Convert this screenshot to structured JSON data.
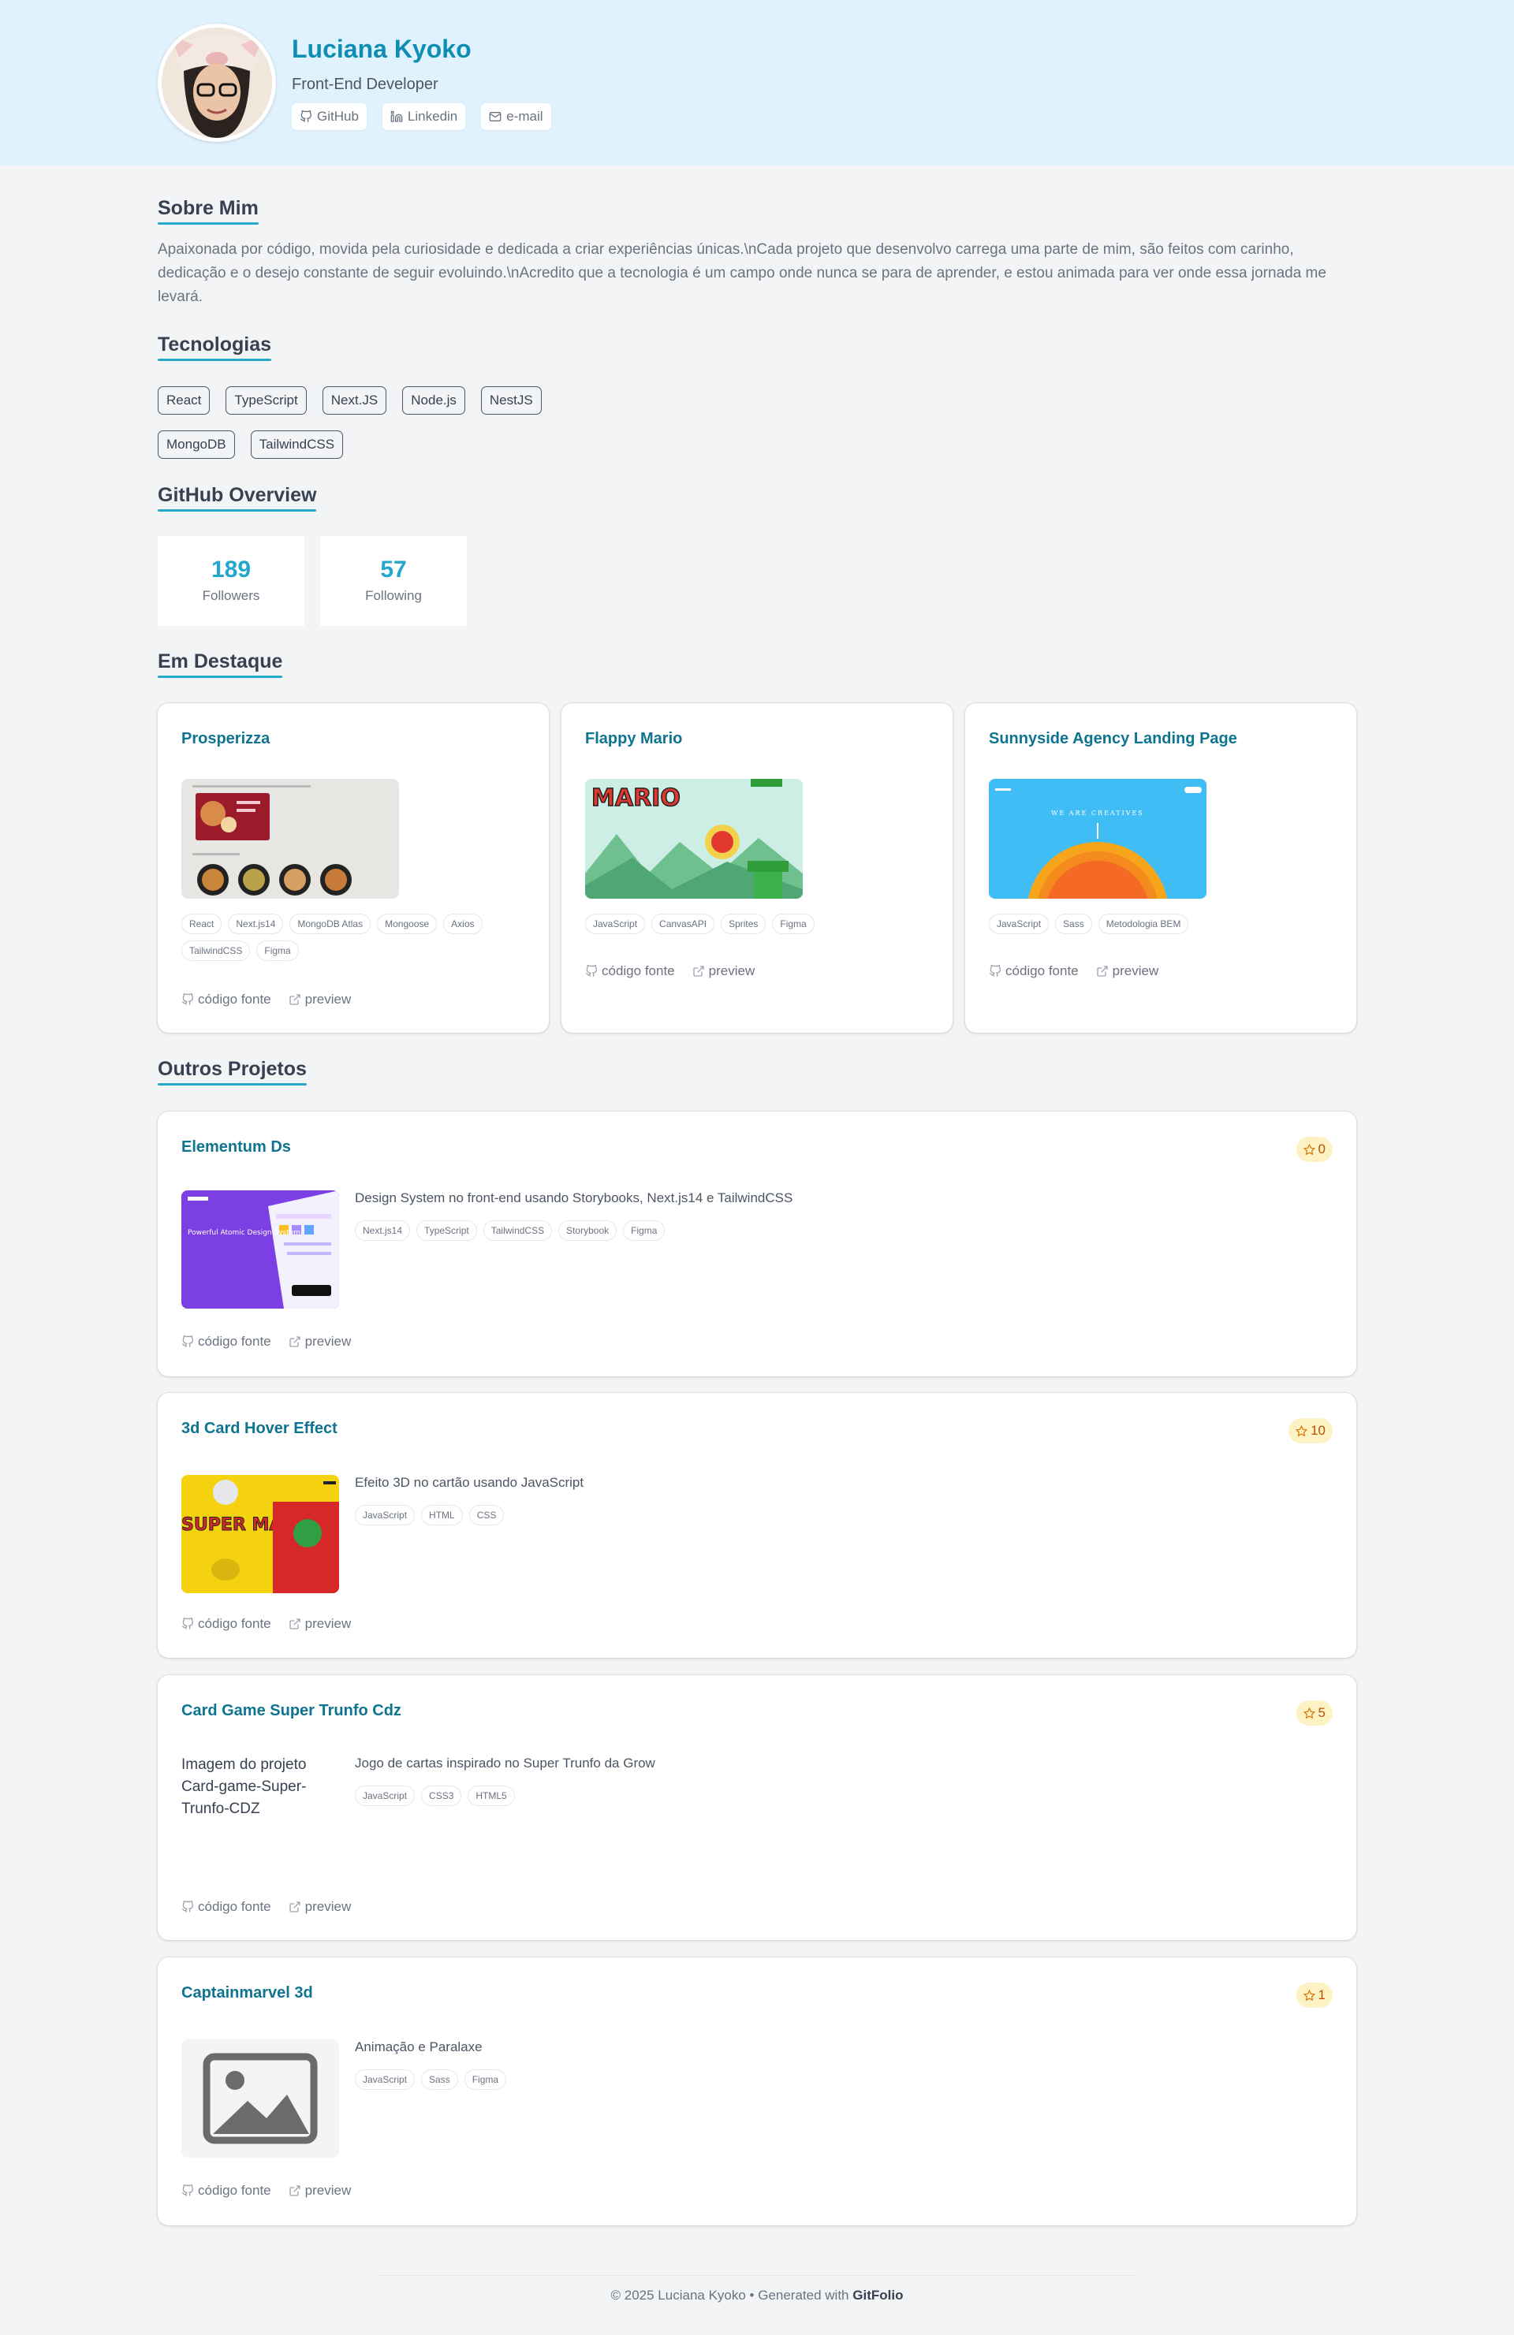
{
  "profile": {
    "name": "Luciana Kyoko",
    "role": "Front-End Developer",
    "links": [
      {
        "label": "GitHub",
        "icon": "github-icon"
      },
      {
        "label": "Linkedin",
        "icon": "linkedin-icon"
      },
      {
        "label": "e-mail",
        "icon": "mail-icon"
      }
    ]
  },
  "about": {
    "title": "Sobre Mim",
    "text": "Apaixonada por código, movida pela curiosidade e dedicada a criar experiências únicas.\\nCada projeto que desenvolvo carrega uma parte de mim, são feitos com carinho, dedicação e o desejo constante de seguir evoluindo.\\nAcredito que a tecnologia é um campo onde nunca se para de aprender, e estou animada para ver onde essa jornada me levará."
  },
  "technologies": {
    "title": "Tecnologias",
    "row1": [
      "React",
      "TypeScript",
      "Next.JS",
      "Node.js",
      "NestJS"
    ],
    "row2": [
      "MongoDB",
      "TailwindCSS"
    ]
  },
  "github": {
    "title": "GitHub Overview",
    "followers": "189",
    "followers_label": "Followers",
    "following": "57",
    "following_label": "Following"
  },
  "featured": {
    "title": "Em Destaque",
    "projects": [
      {
        "name": "Prosperizza",
        "tags": [
          "React",
          "Next.js14",
          "MongoDB Atlas",
          "Mongoose",
          "Axios",
          "TailwindCSS",
          "Figma"
        ]
      },
      {
        "name": "Flappy Mario",
        "tags": [
          "JavaScript",
          "CanvasAPI",
          "Sprites",
          "Figma"
        ],
        "thumb_text": "MARIO"
      },
      {
        "name": "Sunnyside Agency Landing Page",
        "tags": [
          "JavaScript",
          "Sass",
          "Metodologia BEM"
        ],
        "thumb_text": "WE ARE CREATIVES"
      }
    ]
  },
  "others": {
    "title": "Outros Projetos",
    "projects": [
      {
        "name": "Elementum Ds",
        "stars": "0",
        "description": "Design System no front-end usando Storybooks, Next.js14 e TailwindCSS",
        "tags": [
          "Next.js14",
          "TypeScript",
          "TailwindCSS",
          "Storybook",
          "Figma"
        ],
        "thumb_text": "Powerful Atomic Design System"
      },
      {
        "name": "3d Card Hover Effect",
        "stars": "10",
        "description": "Efeito 3D no cartão usando JavaScript",
        "tags": [
          "JavaScript",
          "HTML",
          "CSS"
        ],
        "thumb_text": "SUPER MARIO"
      },
      {
        "name": "Card Game Super Trunfo Cdz",
        "stars": "5",
        "description": "Jogo de cartas inspirado no Super Trunfo da Grow",
        "tags": [
          "JavaScript",
          "CSS3",
          "HTML5"
        ],
        "alt_text": "Imagem do projeto Card-game-Super-Trunfo-CDZ"
      },
      {
        "name": "Captainmarvel 3d",
        "stars": "1",
        "description": "Animação e Paralaxe",
        "tags": [
          "JavaScript",
          "Sass",
          "Figma"
        ]
      }
    ]
  },
  "actions": {
    "source": "código fonte",
    "preview": "preview"
  },
  "footer": {
    "text": "© 2025 Luciana Kyoko • Generated with ",
    "brand": "GitFolio"
  },
  "colors": {
    "accent": "#0e8eb3",
    "header_bg": "#e0f2fe",
    "page_bg": "#f3f4f6",
    "star_bg": "#fdf2c4"
  }
}
